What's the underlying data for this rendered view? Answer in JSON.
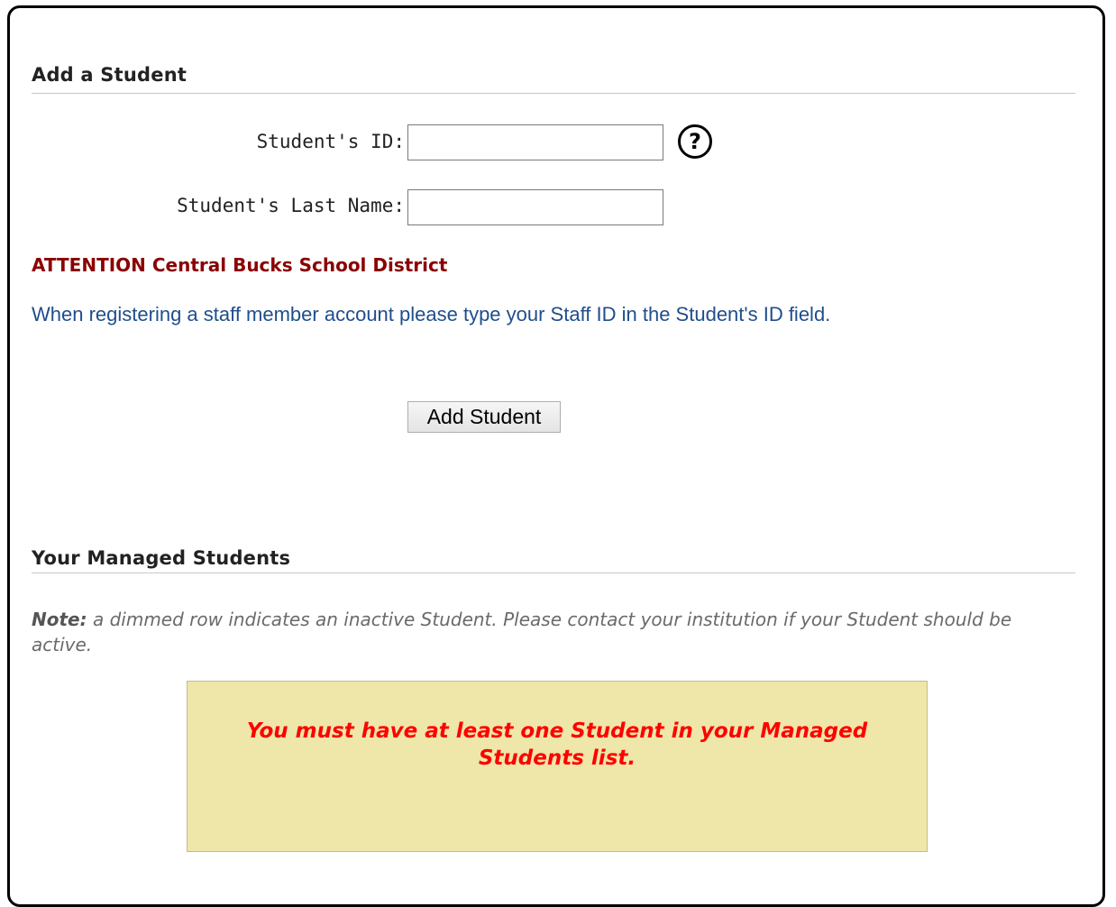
{
  "add_section": {
    "title": "Add a Student",
    "student_id_label": "Student's ID:",
    "student_id_value": "",
    "last_name_label": "Student's Last Name:",
    "last_name_value": "",
    "help_icon": "question-circle-icon",
    "help_glyph": "?",
    "attention": "ATTENTION Central Bucks School District",
    "staff_note": "When registering a staff member account please type your Staff ID in the Student's ID  field.",
    "add_button_label": "Add Student"
  },
  "managed_section": {
    "title": "Your Managed Students",
    "note_label": "Note:",
    "note_text": " a dimmed row indicates an inactive Student. Please contact your institution if your Student should be active.",
    "warning": "You must have at least one Student in your Managed Students list."
  },
  "colors": {
    "attention": "#8b0000",
    "staff_note": "#1f4e8c",
    "warning_text": "#ff0000",
    "warning_bg": "#efe6a9"
  }
}
